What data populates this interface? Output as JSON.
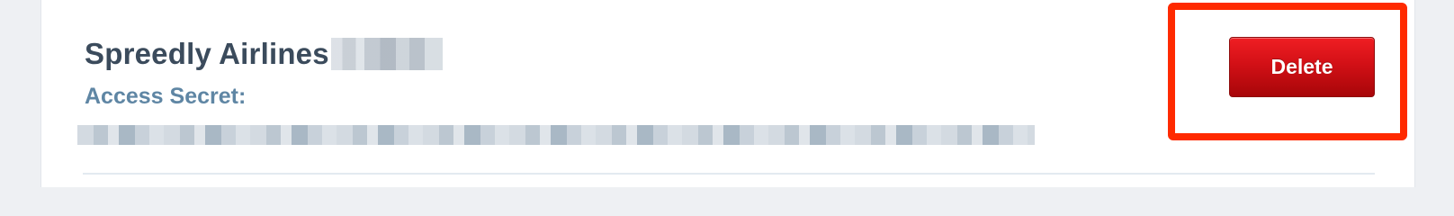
{
  "app": {
    "name": "Spreedly Airlines",
    "access_secret_label": "Access Secret:"
  },
  "actions": {
    "delete_label": "Delete"
  },
  "colors": {
    "accent_red": "#d21016",
    "highlight_red": "#ff2a00",
    "title_text": "#3b4b5c",
    "label_text": "#5f86a4"
  }
}
